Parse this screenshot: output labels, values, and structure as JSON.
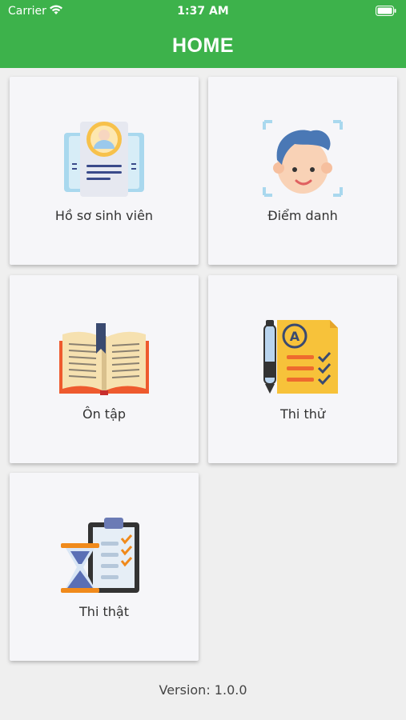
{
  "status_bar": {
    "carrier": "Carrier",
    "time": "1:37 AM"
  },
  "header": {
    "title": "HOME"
  },
  "menu": {
    "items": [
      {
        "label": "Hồ sơ sinh viên",
        "icon": "student-profile-icon"
      },
      {
        "label": "Điểm danh",
        "icon": "face-scan-icon"
      },
      {
        "label": "Ôn tập",
        "icon": "open-book-icon"
      },
      {
        "label": "Thi thử",
        "icon": "exam-checklist-icon"
      },
      {
        "label": "Thi thật",
        "icon": "hourglass-clipboard-icon"
      }
    ]
  },
  "footer": {
    "version": "Version: 1.0.0"
  },
  "colors": {
    "header": "#3db24b",
    "background": "#efefef",
    "card": "#f6f6f9"
  }
}
